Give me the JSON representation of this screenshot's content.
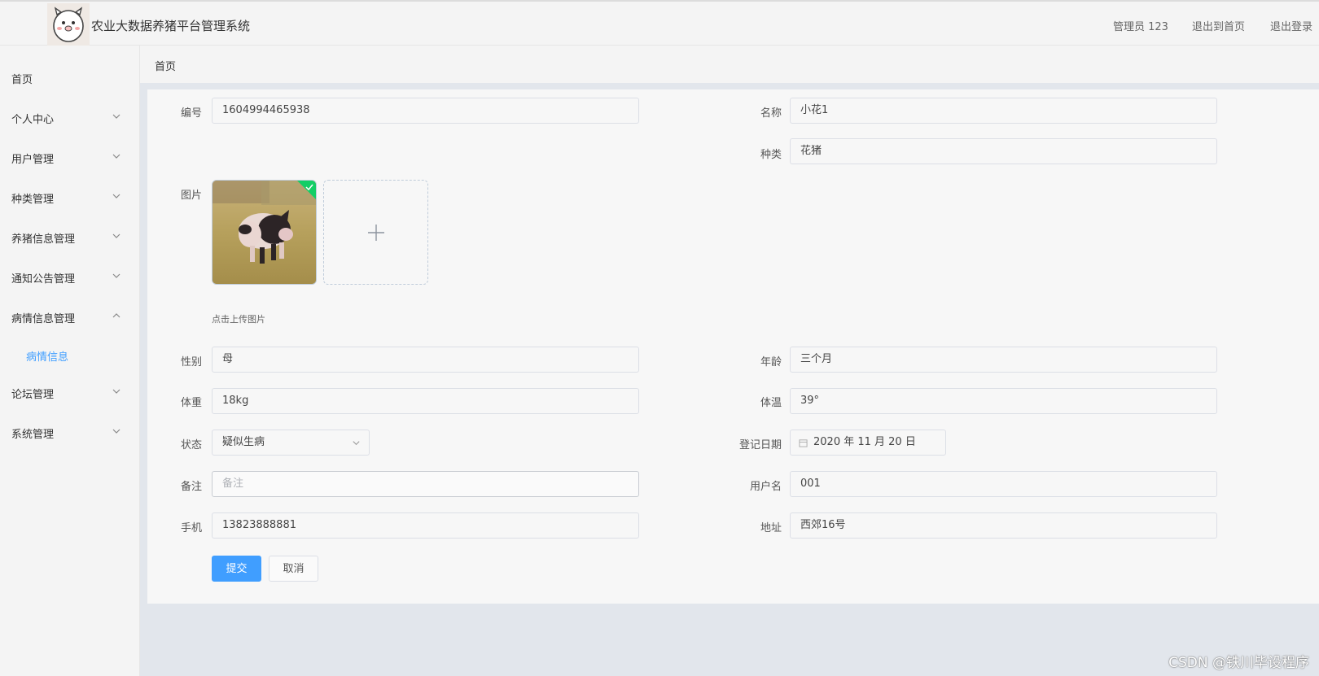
{
  "header": {
    "title": "农业大数据养猪平台管理系统",
    "user": "管理员 123",
    "back_home": "退出到首页",
    "logout": "退出登录"
  },
  "sidebar": {
    "items": [
      {
        "label": "首页"
      },
      {
        "label": "个人中心"
      },
      {
        "label": "用户管理"
      },
      {
        "label": "种类管理"
      },
      {
        "label": "养猪信息管理"
      },
      {
        "label": "通知公告管理"
      },
      {
        "label": "病情信息管理"
      },
      {
        "label": "论坛管理"
      },
      {
        "label": "系统管理"
      }
    ],
    "active_sub": "病情信息"
  },
  "breadcrumb": "首页",
  "form": {
    "code": {
      "label": "编号",
      "value": "1604994465938"
    },
    "name": {
      "label": "名称",
      "value": "小花1"
    },
    "category": {
      "label": "种类",
      "value": "花猪"
    },
    "image": {
      "label": "图片",
      "tip": "点击上传图片"
    },
    "gender": {
      "label": "性别",
      "value": "母"
    },
    "age": {
      "label": "年龄",
      "value": "三个月"
    },
    "weight": {
      "label": "体重",
      "value": "18kg"
    },
    "temperature": {
      "label": "体温",
      "value": "39°"
    },
    "status": {
      "label": "状态",
      "value": "疑似生病"
    },
    "reg_date": {
      "label": "登记日期",
      "value": "2020 年 11 月 20 日"
    },
    "remark": {
      "label": "备注",
      "placeholder": "备注",
      "value": ""
    },
    "username": {
      "label": "用户名",
      "value": "001"
    },
    "phone": {
      "label": "手机",
      "value": "13823888881"
    },
    "address": {
      "label": "地址",
      "value": "西郊16号"
    }
  },
  "buttons": {
    "submit": "提交",
    "cancel": "取消"
  },
  "watermark": "CSDN @铁川毕设程序",
  "colors": {
    "primary": "#409eff",
    "success": "#13ce66"
  }
}
